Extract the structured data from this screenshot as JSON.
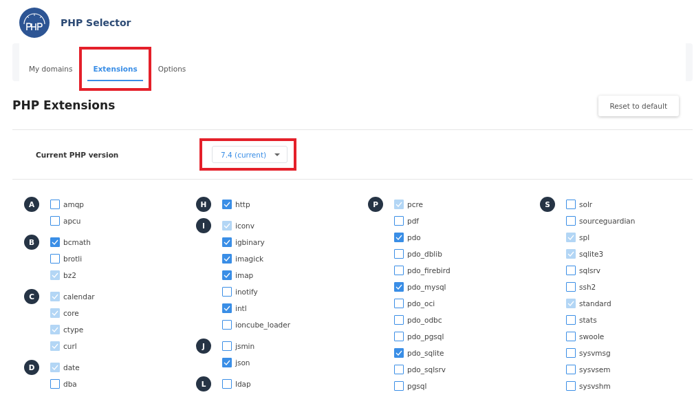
{
  "header": {
    "title": "PHP Selector"
  },
  "tabs": [
    {
      "label": "My domains",
      "selected": false,
      "highlighted": false
    },
    {
      "label": "Extensions",
      "selected": true,
      "highlighted": true
    },
    {
      "label": "Options",
      "selected": false,
      "highlighted": false
    }
  ],
  "heading": "PHP Extensions",
  "reset_button": "Reset to default",
  "version": {
    "label": "Current PHP version",
    "value": "7.4 (current)",
    "highlighted": true
  },
  "columns": [
    {
      "groups": [
        {
          "letter": "A",
          "items": [
            {
              "name": "amqp",
              "checked": false,
              "disabled": false
            },
            {
              "name": "apcu",
              "checked": false,
              "disabled": false
            }
          ]
        },
        {
          "letter": "B",
          "items": [
            {
              "name": "bcmath",
              "checked": true,
              "disabled": false
            },
            {
              "name": "brotli",
              "checked": false,
              "disabled": false
            },
            {
              "name": "bz2",
              "checked": true,
              "disabled": true
            }
          ]
        },
        {
          "letter": "C",
          "items": [
            {
              "name": "calendar",
              "checked": true,
              "disabled": true
            },
            {
              "name": "core",
              "checked": true,
              "disabled": true
            },
            {
              "name": "ctype",
              "checked": true,
              "disabled": true
            },
            {
              "name": "curl",
              "checked": true,
              "disabled": true
            }
          ]
        },
        {
          "letter": "D",
          "items": [
            {
              "name": "date",
              "checked": true,
              "disabled": true
            },
            {
              "name": "dba",
              "checked": false,
              "disabled": false
            }
          ]
        }
      ]
    },
    {
      "groups": [
        {
          "letter": "H",
          "items": [
            {
              "name": "http",
              "checked": true,
              "disabled": false
            }
          ]
        },
        {
          "letter": "I",
          "items": [
            {
              "name": "iconv",
              "checked": true,
              "disabled": true
            },
            {
              "name": "igbinary",
              "checked": true,
              "disabled": false
            },
            {
              "name": "imagick",
              "checked": true,
              "disabled": false
            },
            {
              "name": "imap",
              "checked": true,
              "disabled": false
            },
            {
              "name": "inotify",
              "checked": false,
              "disabled": false
            },
            {
              "name": "intl",
              "checked": true,
              "disabled": false
            },
            {
              "name": "ioncube_loader",
              "checked": false,
              "disabled": false
            }
          ]
        },
        {
          "letter": "J",
          "items": [
            {
              "name": "jsmin",
              "checked": false,
              "disabled": false
            },
            {
              "name": "json",
              "checked": true,
              "disabled": false
            }
          ]
        },
        {
          "letter": "L",
          "items": [
            {
              "name": "ldap",
              "checked": false,
              "disabled": false
            }
          ]
        }
      ]
    },
    {
      "groups": [
        {
          "letter": "P",
          "items": [
            {
              "name": "pcre",
              "checked": true,
              "disabled": true
            },
            {
              "name": "pdf",
              "checked": false,
              "disabled": false
            },
            {
              "name": "pdo",
              "checked": true,
              "disabled": false
            },
            {
              "name": "pdo_dblib",
              "checked": false,
              "disabled": false
            },
            {
              "name": "pdo_firebird",
              "checked": false,
              "disabled": false
            },
            {
              "name": "pdo_mysql",
              "checked": true,
              "disabled": false
            },
            {
              "name": "pdo_oci",
              "checked": false,
              "disabled": false
            },
            {
              "name": "pdo_odbc",
              "checked": false,
              "disabled": false
            },
            {
              "name": "pdo_pgsql",
              "checked": false,
              "disabled": false
            },
            {
              "name": "pdo_sqlite",
              "checked": true,
              "disabled": false
            },
            {
              "name": "pdo_sqlsrv",
              "checked": false,
              "disabled": false
            },
            {
              "name": "pgsql",
              "checked": false,
              "disabled": false
            }
          ]
        }
      ]
    },
    {
      "groups": [
        {
          "letter": "S",
          "items": [
            {
              "name": "solr",
              "checked": false,
              "disabled": false
            },
            {
              "name": "sourceguardian",
              "checked": false,
              "disabled": false
            },
            {
              "name": "spl",
              "checked": true,
              "disabled": true
            },
            {
              "name": "sqlite3",
              "checked": true,
              "disabled": true
            },
            {
              "name": "sqlsrv",
              "checked": false,
              "disabled": false
            },
            {
              "name": "ssh2",
              "checked": false,
              "disabled": false
            },
            {
              "name": "standard",
              "checked": true,
              "disabled": true
            },
            {
              "name": "stats",
              "checked": false,
              "disabled": false
            },
            {
              "name": "swoole",
              "checked": false,
              "disabled": false
            },
            {
              "name": "sysvmsg",
              "checked": false,
              "disabled": false
            },
            {
              "name": "sysvsem",
              "checked": false,
              "disabled": false
            },
            {
              "name": "sysvshm",
              "checked": false,
              "disabled": false
            }
          ]
        }
      ]
    }
  ]
}
